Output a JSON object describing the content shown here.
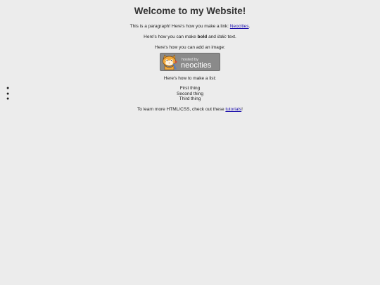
{
  "heading": "Welcome to my Website!",
  "paragraph1": {
    "before": "This is a paragraph! Here's how you make a link: ",
    "link": "Neocities",
    "after": "."
  },
  "paragraph2": {
    "before": "Here's how you can make ",
    "bold": "bold",
    "middle": " and ",
    "italic": "italic",
    "after": " text."
  },
  "paragraph3": "Here's how you can add an image:",
  "image": {
    "alt": "Site hosted by Neocities",
    "text_small": "hosted by",
    "text_large": "neocities",
    "background": "#8a8a8a"
  },
  "paragraph4": "Here's how to make a list:",
  "list": [
    "First thing",
    "Second thing",
    "Third thing"
  ],
  "paragraph5": {
    "before": "To learn more HTML/CSS, check out these ",
    "link": "tutorials",
    "after": "!"
  }
}
